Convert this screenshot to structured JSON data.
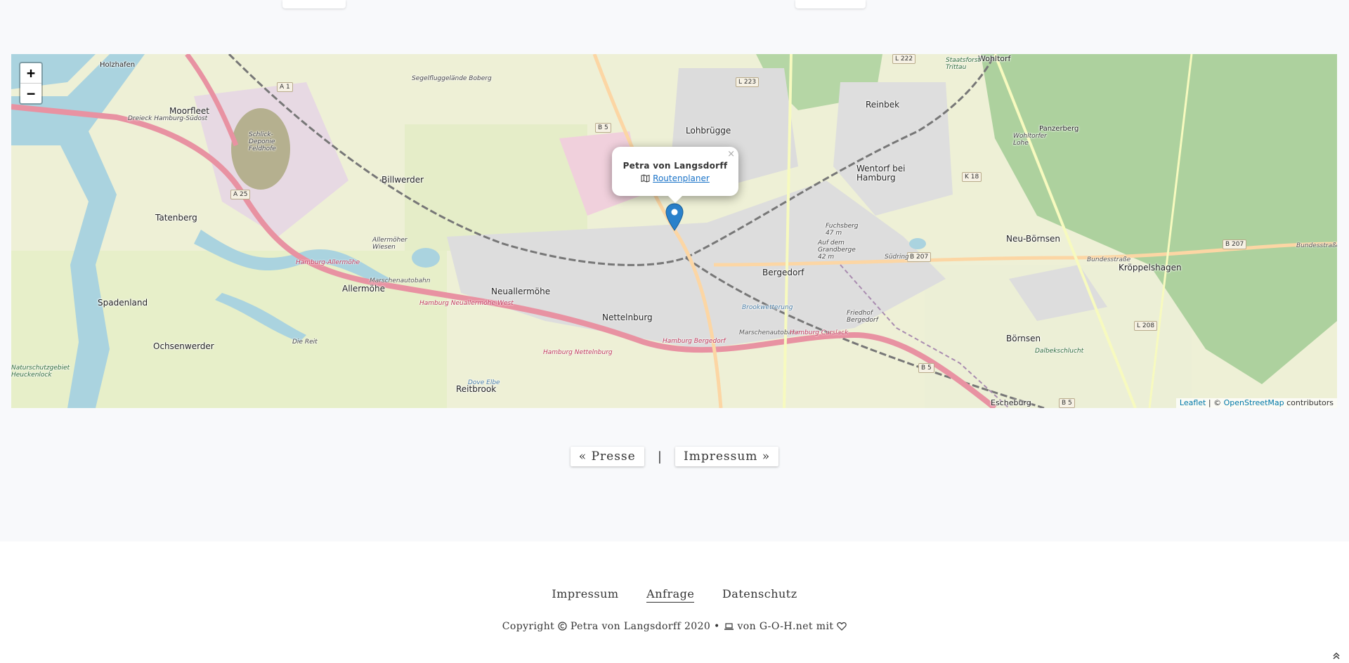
{
  "map": {
    "zoom_in": "+",
    "zoom_out": "−",
    "places": [
      "Holzhafen",
      "Moorfleet",
      "Dreieck Hamburg-Südost",
      "Tatenberg",
      "Spadenland",
      "Ochsenwerder",
      "Billwerder",
      "Allermöhe",
      "Neuallermöhe",
      "Nettelnburg",
      "Reitbrook",
      "Lohbrügge",
      "Reinbek",
      "Wentorf bei Hamburg",
      "Bergedorf",
      "Neu-Börnsen",
      "Kröppelshagen",
      "Börnsen",
      "Escheburg",
      "Wohltorf",
      "Panzerberg"
    ],
    "small_labels": [
      "Segelfluggelände Boberg",
      "Schlick-Deponie Feldhofe",
      "Allermöher Wiesen",
      "Die Reit",
      "Dove Elbe",
      "Dalbekschlucht",
      "Fuchsberg 47 m",
      "Auf dem Grandberge 42 m",
      "Friedhof Bergedorf",
      "Wohltorfer Lohe",
      "Staatsforst Trittau",
      "Naturschutzgebiet Heuckenlock",
      "Brookwetterung"
    ],
    "road_signs": [
      "A 1",
      "A 25",
      "B 5",
      "L 223",
      "L 222",
      "K 18",
      "B 207",
      "B 207",
      "L 208",
      "B 5",
      "B 5"
    ],
    "road_labels": [
      "Hamburg-Allermöhe",
      "Hamburg Neuallermöhe-West",
      "Marschenautobahn",
      "Hamburg Nettelnburg",
      "Hamburg Bergedorf",
      "Marschenautobahn",
      "Hamburg Curslack",
      "Südring",
      "Bundesstraße",
      "Bundesstraße"
    ],
    "popup": {
      "title": "Petra von Langsdorff",
      "link": "Routenplaner",
      "close": "×"
    },
    "attribution": {
      "leaflet": "Leaflet",
      "sep": " | © ",
      "osm": "OpenStreetMap",
      "suffix": " contributors"
    }
  },
  "pager": {
    "prev": "« Presse",
    "separator": "|",
    "next": "Impressum »"
  },
  "footer": {
    "nav": [
      "Impressum",
      "Anfrage",
      "Datenschutz"
    ],
    "copyright_pre": "Copyright",
    "copyright_owner": "Petra von Langsdorff 2020 •",
    "copyright_by": "von G-O-H.net mit"
  }
}
